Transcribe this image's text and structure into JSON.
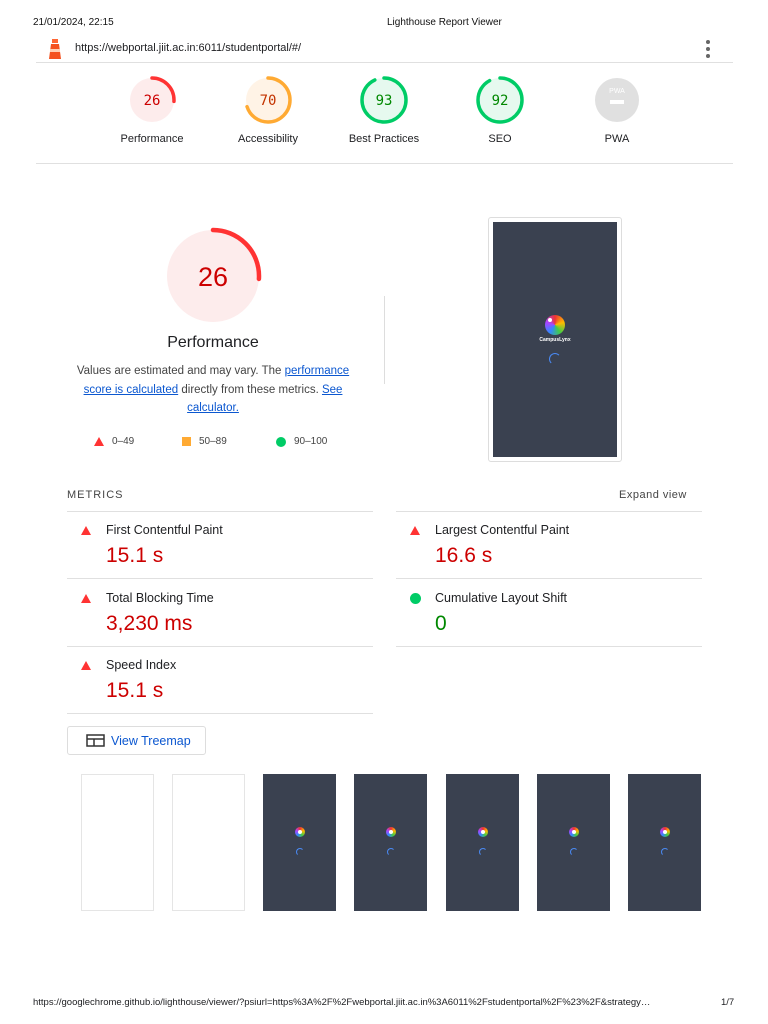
{
  "print_header": {
    "datetime": "21/01/2024, 22:15",
    "title": "Lighthouse Report Viewer"
  },
  "topbar": {
    "url": "https://webportal.jiit.ac.in:6011/studentportal/#/"
  },
  "categories": [
    {
      "label": "Performance",
      "score": "26",
      "value": 26,
      "color": "#ff3333",
      "bg": "#fdecec",
      "text": "#cc0000"
    },
    {
      "label": "Accessibility",
      "score": "70",
      "value": 70,
      "color": "#ffaa33",
      "bg": "#fff3e6",
      "text": "#c33300"
    },
    {
      "label": "Best Practices",
      "score": "93",
      "value": 93,
      "color": "#00cc66",
      "bg": "#e6f9ef",
      "text": "#008800"
    },
    {
      "label": "SEO",
      "score": "92",
      "value": 92,
      "color": "#00cc66",
      "bg": "#e6f9ef",
      "text": "#008800"
    },
    {
      "label": "PWA",
      "score": "PWA",
      "value": 0,
      "color": "#cccccc",
      "bg": "#e0e0e0",
      "text": "#ffffff"
    }
  ],
  "performance": {
    "score": "26",
    "value": 26,
    "title": "Performance",
    "desc_1": "Values are estimated and may vary. The ",
    "link_1": "performance score is calculated",
    "desc_2": " directly from these metrics. ",
    "link_2": "See calculator."
  },
  "legend": [
    "0–49",
    "50–89",
    "90–100"
  ],
  "screenshot": {
    "brand": "CampusLynx"
  },
  "metrics": {
    "heading": "METRICS",
    "expand": "Expand view",
    "items": [
      {
        "label": "First Contentful Paint",
        "value": "15.1 s",
        "status": "fail"
      },
      {
        "label": "Largest Contentful Paint",
        "value": "16.6 s",
        "status": "fail"
      },
      {
        "label": "Total Blocking Time",
        "value": "3,230 ms",
        "status": "fail"
      },
      {
        "label": "Cumulative Layout Shift",
        "value": "0",
        "status": "pass"
      },
      {
        "label": "Speed Index",
        "value": "15.1 s",
        "status": "fail"
      }
    ]
  },
  "treemap_button": "View Treemap",
  "print_footer": {
    "url": "https://googlechrome.github.io/lighthouse/viewer/?psiurl=https%3A%2F%2Fwebportal.jiit.ac.in%3A6011%2Fstudentportal%2F%23%2F&strategy…",
    "page": "1/7"
  }
}
